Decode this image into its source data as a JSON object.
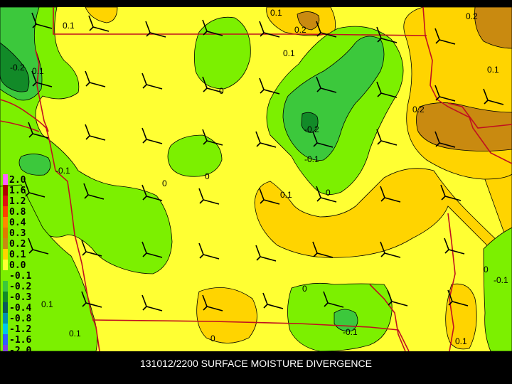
{
  "title": "131012/2200 SURFACE MOISTURE DIVERGENCE",
  "colors": {
    "band_pos_0_2": "#c98a10",
    "band_pos_0_1": "#ffd400",
    "band_0": "#ffff33",
    "band_neg_0_1": "#7cf000",
    "band_neg_0_2": "#3cc83c",
    "band_neg_0_3": "#128a28",
    "band_neg_0_4": "#0a5a28",
    "state_border": "#c01020",
    "contour_line": "#000000",
    "wind_barb": "#000000"
  },
  "legend": {
    "items": [
      {
        "label": "2.0",
        "color": "#ff60ff"
      },
      {
        "label": "1.6",
        "color": "#b00000"
      },
      {
        "label": "1.2",
        "color": "#e01010"
      },
      {
        "label": "0.8",
        "color": "#ff4000"
      },
      {
        "label": "0.4",
        "color": "#ff8800"
      },
      {
        "label": "0.3",
        "color": "#e07a00"
      },
      {
        "label": "0.2",
        "color": "#c98a10"
      },
      {
        "label": "0.1",
        "color": "#ffd400"
      },
      {
        "label": "0.0",
        "color": "#ffff33"
      },
      {
        "label": "-0.1",
        "color": "#7cf000"
      },
      {
        "label": "-0.2",
        "color": "#3cc83c"
      },
      {
        "label": "-0.3",
        "color": "#128a28"
      },
      {
        "label": "-0.4",
        "color": "#0a5a5a"
      },
      {
        "label": "-0.8",
        "color": "#0090b0"
      },
      {
        "label": "-1.2",
        "color": "#00c8e8"
      },
      {
        "label": "-1.6",
        "color": "#3060ff"
      },
      {
        "label": "-2.0",
        "color": "#8040e0"
      }
    ]
  },
  "contour_labels": [
    {
      "text": "0.1"
    },
    {
      "text": "0.2"
    },
    {
      "text": "0.2"
    },
    {
      "text": "0.1"
    },
    {
      "text": "0.1"
    },
    {
      "text": "-0.2"
    },
    {
      "text": "0.1"
    },
    {
      "text": "0"
    },
    {
      "text": "0.2"
    },
    {
      "text": "-0.2"
    },
    {
      "text": "-0.1"
    },
    {
      "text": "-0.1"
    },
    {
      "text": "0"
    },
    {
      "text": "0"
    },
    {
      "text": "0.1"
    },
    {
      "text": "0"
    },
    {
      "text": "0"
    },
    {
      "text": "-0.1"
    },
    {
      "text": "0.1"
    },
    {
      "text": "0"
    },
    {
      "text": "0.1"
    },
    {
      "text": "0"
    },
    {
      "text": "-0.1"
    },
    {
      "text": "0.1"
    },
    {
      "text": "0.1"
    }
  ]
}
